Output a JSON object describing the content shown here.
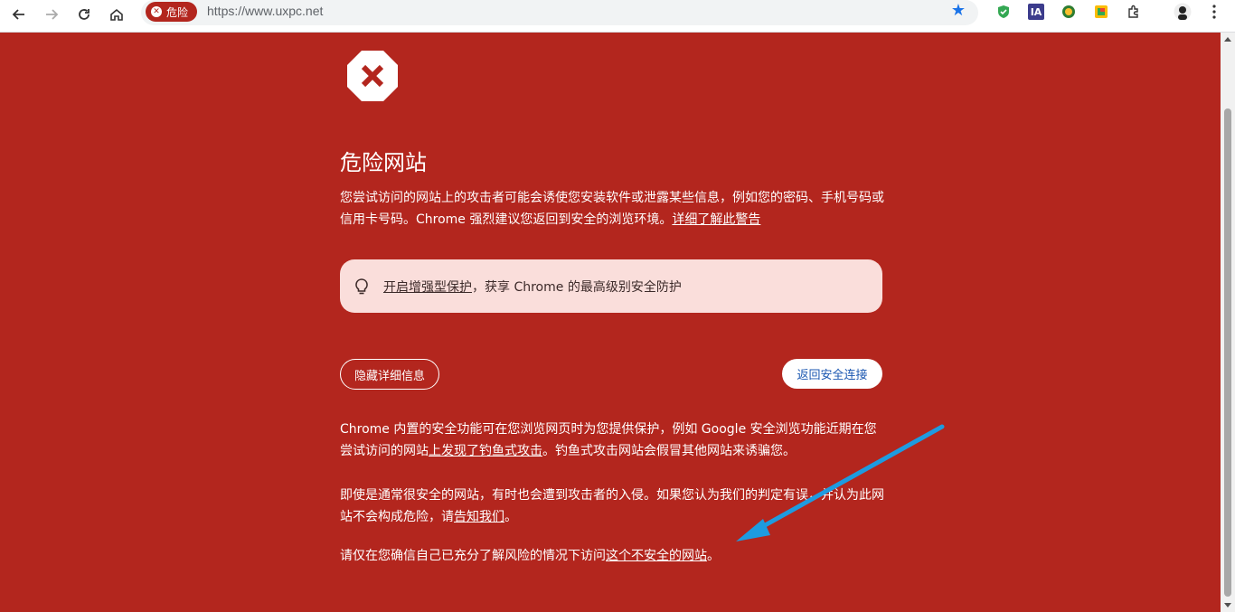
{
  "browser": {
    "danger_chip_label": "危险",
    "url": "https://www.uxpc.net",
    "accent_color": "#1a73e8"
  },
  "page": {
    "background_color": "#b3261e",
    "title": "危险网站",
    "intro_text": "您尝试访问的网站上的攻击者可能会诱使您安装软件或泄露某些信息，例如您的密码、手机号码或信用卡号码。Chrome 强烈建议您返回到安全的浏览环境。",
    "learn_more_link": "详细了解此警告",
    "enhanced": {
      "link": "开启增强型保护",
      "text": "，获享 Chrome 的最高级别安全防护"
    },
    "hide_details_button": "隐藏详细信息",
    "back_to_safety_button": "返回安全连接",
    "details_p1_a": "Chrome 内置的安全功能可在您浏览网页时为您提供保护，例如 Google 安全浏览功能近期在您尝试访问的网站",
    "details_p1_link": "上发现了钓鱼式攻击",
    "details_p1_b": "。钓鱼式攻击网站会假冒其他网站来诱骗您。",
    "details_p2_a": "即使是通常很安全的网站，有时也会遭到攻击者的入侵。如果您认为我们的判定有误，并认为此网站不会构成危险，请",
    "details_p2_link": "告知我们",
    "details_p2_b": "。",
    "details_p3_a": "请仅在您确信自己已充分了解风险的情况下访问",
    "details_p3_link": "这个不安全的网站",
    "details_p3_b": "。"
  }
}
